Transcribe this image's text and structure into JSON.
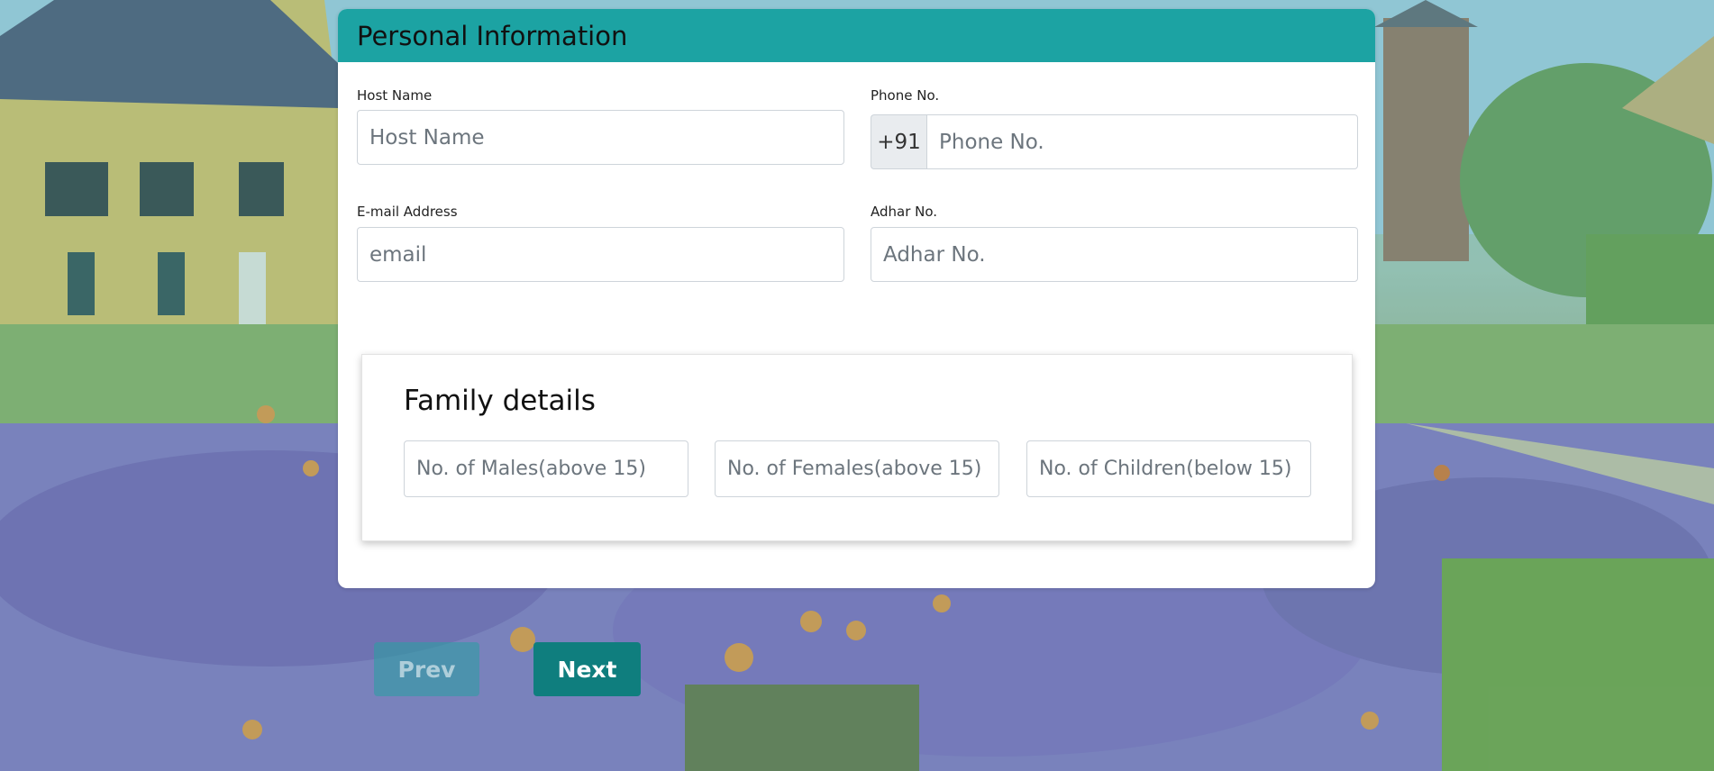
{
  "form": {
    "title": "Personal Information",
    "host_name": {
      "label": "Host Name",
      "placeholder": "Host Name"
    },
    "phone": {
      "label": "Phone No.",
      "prefix": "+91",
      "placeholder": "Phone No."
    },
    "email": {
      "label": "E-mail Address",
      "placeholder": "email"
    },
    "adhar": {
      "label": "Adhar No.",
      "placeholder": "Adhar No."
    }
  },
  "family": {
    "title": "Family details",
    "males_placeholder": "No. of Males(above 15)",
    "females_placeholder": "No. of Females(above 15)",
    "children_placeholder": "No. of Children(below 15)"
  },
  "nav": {
    "prev_label": "Prev",
    "next_label": "Next"
  },
  "colors": {
    "header": "#1ca3a3",
    "next_button": "#0f7e7e",
    "prev_button_disabled": "#28a0a0"
  }
}
